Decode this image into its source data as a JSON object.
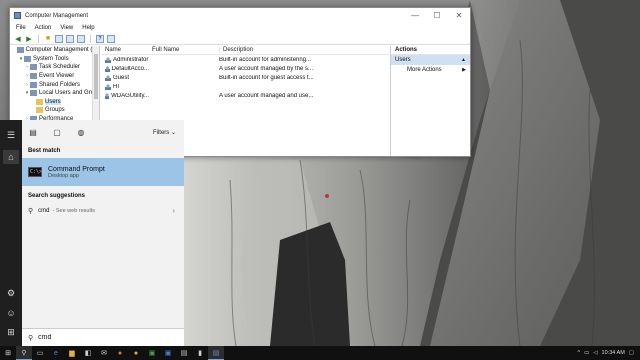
{
  "window": {
    "title": "Computer Management",
    "controls": {
      "minimize": "—",
      "maximize": "☐",
      "close": "✕"
    }
  },
  "menu": [
    "File",
    "Action",
    "View",
    "Help"
  ],
  "tree": [
    {
      "label": "Computer Management (Lo",
      "indent": 0,
      "twisty": ""
    },
    {
      "label": "System Tools",
      "indent": 1,
      "twisty": "▾"
    },
    {
      "label": "Task Scheduler",
      "indent": 2,
      "twisty": "›"
    },
    {
      "label": "Event Viewer",
      "indent": 2,
      "twisty": "›"
    },
    {
      "label": "Shared Folders",
      "indent": 2,
      "twisty": "›"
    },
    {
      "label": "Local Users and Grou",
      "indent": 2,
      "twisty": "▾"
    },
    {
      "label": "Users",
      "indent": 3,
      "twisty": "",
      "selected": true
    },
    {
      "label": "Groups",
      "indent": 3,
      "twisty": ""
    },
    {
      "label": "Performance",
      "indent": 2,
      "twisty": "›"
    }
  ],
  "list": {
    "columns": [
      "Name",
      "Full Name",
      "Description"
    ],
    "rows": [
      {
        "name": "Administrator",
        "full": "",
        "desc": "Built-in account for administering..."
      },
      {
        "name": "DefaultAcco...",
        "full": "",
        "desc": "A user account managed by the s..."
      },
      {
        "name": "Guest",
        "full": "",
        "desc": "Built-in account for guest access t..."
      },
      {
        "name": "HI",
        "full": "",
        "desc": ""
      },
      {
        "name": "WDAGUtility...",
        "full": "",
        "desc": "A user account managed and use..."
      }
    ]
  },
  "actions": {
    "header": "Actions",
    "group": "Users",
    "more": "More Actions"
  },
  "search": {
    "filters_label": "Filters",
    "best_match_title": "Best match",
    "best_match_name": "Command Prompt",
    "best_match_kind": "Desktop app",
    "cmd_icon_text": "C:\\>",
    "suggestions_title": "Search suggestions",
    "suggestion_query": "cmd",
    "suggestion_suffix": "- See web results",
    "query": "cmd"
  },
  "taskbar": {
    "time": "10:34 AM"
  },
  "colors": {
    "highlight": "#9bc4e6",
    "tree_selected": "#cde4f7",
    "actions_group": "#cfe0f2"
  }
}
